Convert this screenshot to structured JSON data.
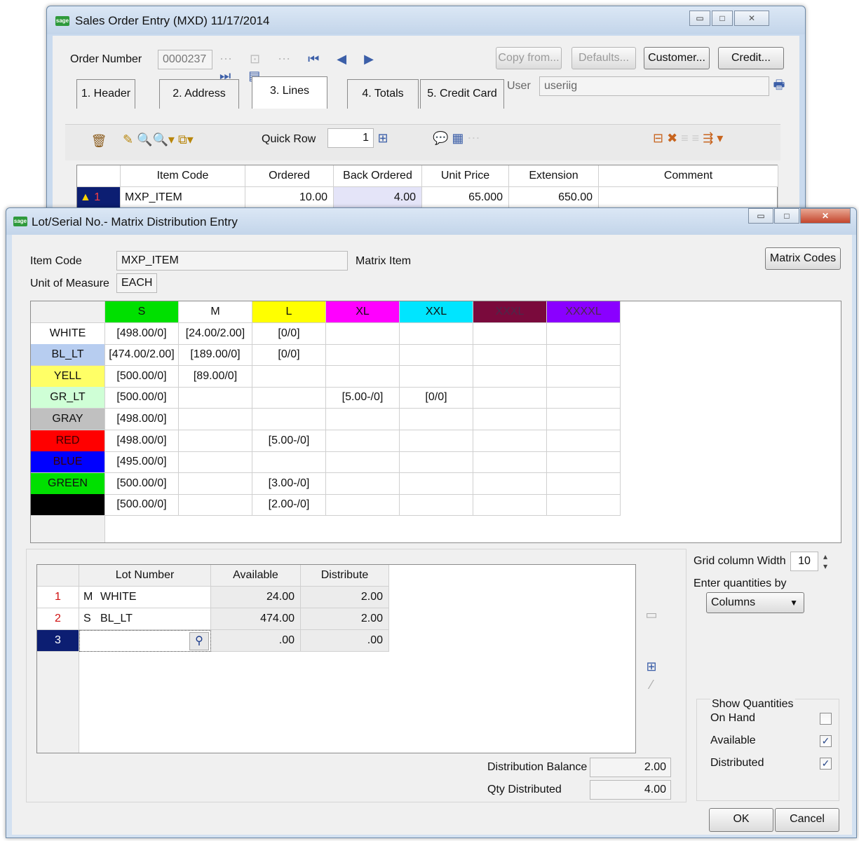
{
  "back_window": {
    "title": "Sales Order Entry (MXD) 11/17/2014",
    "order_number_label": "Order Number",
    "order_number": "0000237",
    "buttons": {
      "copy_from": "Copy from...",
      "defaults": "Defaults...",
      "customer": "Customer...",
      "credit": "Credit..."
    },
    "tabs": [
      "1. Header",
      "2. Address",
      "3. Lines",
      "4. Totals",
      "5. Credit Card"
    ],
    "user_label": "User",
    "user_value": "useriig",
    "quick_row_label": "Quick Row",
    "quick_row_value": "1",
    "lines_columns": [
      "Item Code",
      "Ordered",
      "Back Ordered",
      "Unit Price",
      "Extension",
      "Comment"
    ],
    "lines_row": {
      "num": "1",
      "item_code": "MXP_ITEM",
      "ordered": "10.00",
      "back_ordered": "4.00",
      "unit_price": "65.000",
      "extension": "650.00",
      "comment": ""
    }
  },
  "dialog": {
    "title": "Lot/Serial No.- Matrix Distribution Entry",
    "item_code_label": "Item Code",
    "item_code": "MXP_ITEM",
    "matrix_item_label": "Matrix Item",
    "uom_label": "Unit of Measure",
    "uom": "EACH",
    "matrix_codes_button": "Matrix Codes",
    "matrix": {
      "columns": [
        {
          "label": "S",
          "color": "#00e000"
        },
        {
          "label": "M",
          "color": "#ffffff"
        },
        {
          "label": "L",
          "color": "#ffff00"
        },
        {
          "label": "XL",
          "color": "#ff00ff"
        },
        {
          "label": "XXL",
          "color": "#00e5ff"
        },
        {
          "label": "XXXL",
          "color": "#7a0a3c"
        },
        {
          "label": "XXXXL",
          "color": "#8a00ff"
        }
      ],
      "rows": [
        {
          "label": "WHITE",
          "color": "#ffffff",
          "values": [
            "[498.00/0]",
            "[24.00/2.00]",
            "[0/0]",
            "",
            "",
            "",
            ""
          ]
        },
        {
          "label": "BL_LT",
          "color": "#b7cdf0",
          "values": [
            "[474.00/2.00]",
            "[189.00/0]",
            "[0/0]",
            "",
            "",
            "",
            ""
          ]
        },
        {
          "label": "YELL",
          "color": "#ffff66",
          "values": [
            "[500.00/0]",
            "[89.00/0]",
            "",
            "",
            "",
            "",
            ""
          ]
        },
        {
          "label": "GR_LT",
          "color": "#cfffd6",
          "values": [
            "[500.00/0]",
            "",
            "",
            "[5.00-/0]",
            "[0/0]",
            "",
            ""
          ]
        },
        {
          "label": "GRAY",
          "color": "#c0c0c0",
          "values": [
            "[498.00/0]",
            "",
            "",
            "",
            "",
            "",
            ""
          ]
        },
        {
          "label": "RED",
          "color": "#ff0000",
          "values": [
            "[498.00/0]",
            "",
            "[5.00-/0]",
            "",
            "",
            "",
            ""
          ]
        },
        {
          "label": "BLUE",
          "color": "#0000ff",
          "values": [
            "[495.00/0]",
            "",
            "",
            "",
            "",
            "",
            ""
          ]
        },
        {
          "label": "GREEN",
          "color": "#00e000",
          "values": [
            "[500.00/0]",
            "",
            "[3.00-/0]",
            "",
            "",
            "",
            ""
          ]
        },
        {
          "label": "",
          "color": "#000000",
          "values": [
            "[500.00/0]",
            "",
            "[2.00-/0]",
            "",
            "",
            "",
            ""
          ]
        }
      ]
    },
    "lots": {
      "columns": [
        "Lot Number",
        "Available",
        "Distribute"
      ],
      "rows": [
        {
          "num": "1",
          "code": "M",
          "lot": "WHITE",
          "available": "24.00",
          "distribute": "2.00"
        },
        {
          "num": "2",
          "code": "S",
          "lot": "BL_LT",
          "available": "474.00",
          "distribute": "2.00"
        },
        {
          "num": "3",
          "code": "",
          "lot": "",
          "available": ".00",
          "distribute": ".00"
        }
      ]
    },
    "grid_col_width_label": "Grid column Width",
    "grid_col_width": "10",
    "enter_qty_label": "Enter quantities by",
    "enter_qty_value": "Columns",
    "show_qty": {
      "title": "Show Quantities",
      "items": [
        {
          "label": "On Hand",
          "checked": false
        },
        {
          "label": "Available",
          "checked": true
        },
        {
          "label": "Distributed",
          "checked": true
        }
      ]
    },
    "distribution_balance_label": "Distribution Balance",
    "distribution_balance": "2.00",
    "qty_distributed_label": "Qty Distributed",
    "qty_distributed": "4.00",
    "ok_button": "OK",
    "cancel_button": "Cancel"
  }
}
